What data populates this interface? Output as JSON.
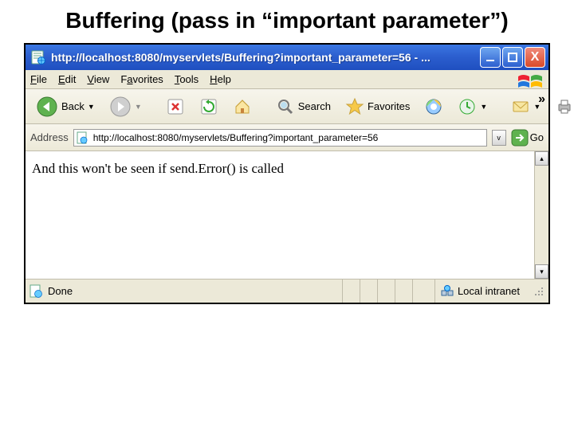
{
  "slide": {
    "title": "Buffering (pass in “important parameter”)"
  },
  "window": {
    "title": "http://localhost:8080/myservlets/Buffering?important_parameter=56 - ..."
  },
  "menu": {
    "items": [
      {
        "key": "F",
        "rest": "ile"
      },
      {
        "key": "E",
        "rest": "dit"
      },
      {
        "key": "V",
        "rest": "iew"
      },
      {
        "key": "A",
        "pre": "F",
        "rest": "vorites"
      },
      {
        "key": "T",
        "rest": "ools"
      },
      {
        "key": "H",
        "rest": "elp"
      }
    ],
    "file": "File",
    "edit": "Edit",
    "view": "View",
    "favorites": "Favorites",
    "tools": "Tools",
    "help": "Help"
  },
  "toolbar": {
    "back": "Back",
    "search": "Search",
    "favorites": "Favorites",
    "overflow": "»"
  },
  "address": {
    "label": "Address",
    "url": "http://localhost:8080/myservlets/Buffering?important_parameter=56",
    "go": "Go"
  },
  "content": {
    "body_text": "And this won't be seen if send.Error() is called"
  },
  "status": {
    "text": "Done",
    "zone": "Local intranet"
  }
}
